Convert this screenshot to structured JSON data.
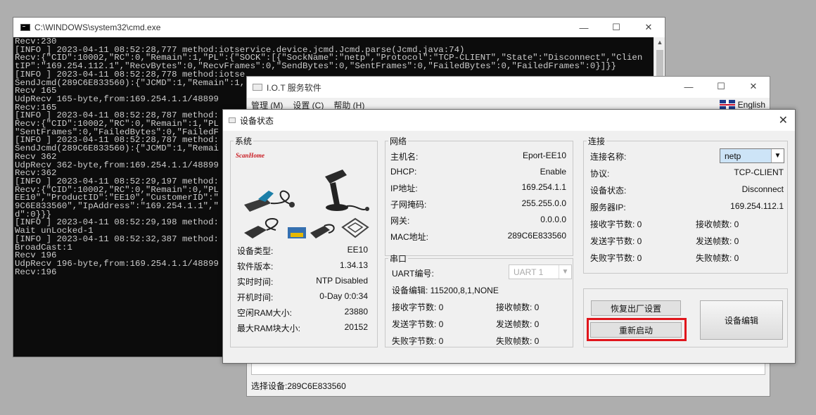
{
  "cmd": {
    "title": "C:\\WINDOWS\\system32\\cmd.exe",
    "buttons": {
      "minimize": "—",
      "maximize": "☐",
      "close": "✕"
    },
    "lines": [
      "Recv:230",
      "[INFO ] 2023-04-11 08:52:28,777 method:iotservice.device.jcmd.Jcmd.parse(Jcmd.java:74)",
      "Recv:{\"CID\":10002,\"RC\":0,\"Remain\":1,\"PL\":{\"SOCK\":[{\"SockName\":\"netp\",\"Protocol\":\"TCP-CLIENT\",\"State\":\"Disconnect\",\"Clien",
      "tIP\":\"169.254.112.1\",\"RecvBytes\":0,\"RecvFrames\":0,\"SendBytes\":0,\"SentFrames\":0,\"FailedBytes\":0,\"FailedFrames\":0}]}}",
      "[INFO ] 2023-04-11 08:52:28,778 method:iotse",
      "SendJcmd(289C6E833560):{\"JCMD\":1,\"Remain\":1,",
      "Recv 165",
      "UdpRecv 165-byte,from:169.254.1.1/48899",
      "Recv:165",
      "[INFO ] 2023-04-11 08:52:28,787 method:",
      "Recv:{\"CID\":10002,\"RC\":0,\"Remain\":1,\"PL",
      "\"SentFrames\":0,\"FailedBytes\":0,\"FailedF",
      "[INFO ] 2023-04-11 08:52:28,787 method:",
      "SendJcmd(289C6E833560):{\"JCMD\":1,\"Remai",
      "Recv 362",
      "UdpRecv 362-byte,from:169.254.1.1/48899",
      "Recv:362",
      "[INFO ] 2023-04-11 08:52:29,197 method:",
      "Recv:{\"CID\":10002,\"RC\":0,\"Remain\":0,\"PL",
      "EE10\",\"ProductID\":\"EE10\",\"CustomerID\":\"",
      "9C6E833560\",\"IpAddress\":\"169.254.1.1\",\"",
      "d\":0}}}",
      "[INFO ] 2023-04-11 08:52:29,198 method:",
      "Wait unLocked-1",
      "[INFO ] 2023-04-11 08:52:32,387 method:",
      "BroadCast:1",
      "Recv 196",
      "UdpRecv 196-byte,from:169.254.1.1/48899",
      "Recv:196"
    ]
  },
  "iot": {
    "title": "I.O.T 服务软件",
    "menu": [
      "管理 (M)",
      "设置 (C)",
      "帮助 (H)"
    ],
    "language": "English",
    "status_bar": "选择设备:289C6E833560"
  },
  "dialog": {
    "title": "设备状态",
    "close": "✕",
    "system": {
      "legend": "系统",
      "brand": "ScanHome",
      "rows": [
        {
          "label": "设备类型:",
          "value": "EE10"
        },
        {
          "label": "软件版本:",
          "value": "1.34.13"
        },
        {
          "label": "实时时间:",
          "value": "NTP Disabled"
        },
        {
          "label": "开机时间:",
          "value": "0-Day 0:0:34"
        },
        {
          "label": "空闲RAM大小:",
          "value": "23880"
        },
        {
          "label": "最大RAM块大小:",
          "value": "20152"
        }
      ]
    },
    "network": {
      "legend": "网络",
      "rows": [
        {
          "label": "主机名:",
          "value": "Eport-EE10"
        },
        {
          "label": "DHCP:",
          "value": "Enable"
        },
        {
          "label": "IP地址:",
          "value": "169.254.1.1"
        },
        {
          "label": "子网掩码:",
          "value": "255.255.0.0"
        },
        {
          "label": "网关:",
          "value": "0.0.0.0"
        },
        {
          "label": "MAC地址:",
          "value": "289C6E833560"
        }
      ]
    },
    "serial": {
      "legend": "串口",
      "uart_label": "UART编号:",
      "uart_value": "UART 1",
      "config": "设备编辑: 115200,8,1,NONE",
      "recv_bytes": "接收字节数: 0",
      "recv_frames": "接收帧数: 0",
      "send_bytes": "发送字节数: 0",
      "send_frames": "发送帧数: 0",
      "fail_bytes": "失败字节数: 0",
      "fail_frames": "失败帧数: 0"
    },
    "connection": {
      "legend": "连接",
      "name_label": "连接名称:",
      "name_value": "netp",
      "rows": [
        {
          "label": "协议:",
          "value": "TCP-CLIENT"
        },
        {
          "label": "设备状态:",
          "value": "Disconnect"
        },
        {
          "label": "服务器IP:",
          "value": "169.254.112.1"
        }
      ],
      "recv_bytes": "接收字节数: 0",
      "recv_frames": "接收帧数: 0",
      "send_bytes": "发送字节数: 0",
      "send_frames": "发送帧数: 0",
      "fail_bytes": "失败字节数: 0",
      "fail_frames": "失败帧数: 0"
    },
    "buttons": {
      "factory_reset": "恢复出厂设置",
      "restart": "重新启动",
      "device_edit": "设备编辑"
    }
  },
  "colors": {
    "highlight": "#e0161c",
    "console_bg": "#0c0c0c",
    "console_text": "#cccccc"
  }
}
